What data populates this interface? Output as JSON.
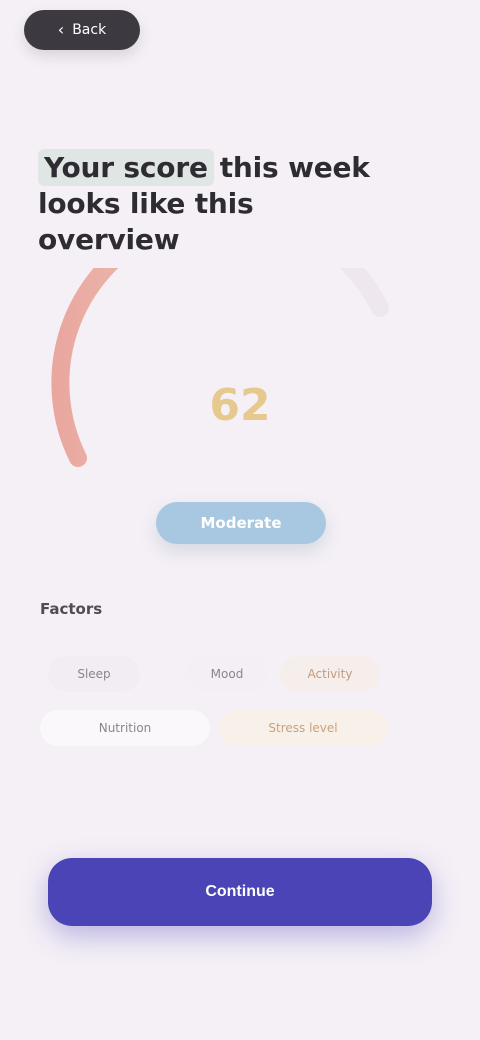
{
  "top_pill": {
    "label": "Back",
    "icon": "chevron-left-icon"
  },
  "headline": {
    "highlight": "Your score",
    "rest": "this week looks like this",
    "line2": "overview"
  },
  "gauge": {
    "value": "62",
    "fraction": 0.62,
    "colors": {
      "start": "#e9a7a0",
      "mid": "#f0cdb6",
      "end": "#efd8a6",
      "track": "#eee7ee"
    }
  },
  "status": {
    "label": "Moderate"
  },
  "factors": {
    "title": "Factors",
    "chips": [
      "Sleep",
      "Mood",
      "Activity",
      "Nutrition",
      "Stress level"
    ]
  },
  "cta": {
    "label": "Continue"
  },
  "colors": {
    "background": "#f5f0f6",
    "accent": "#4a44b6",
    "status": "#a7c8e0"
  }
}
